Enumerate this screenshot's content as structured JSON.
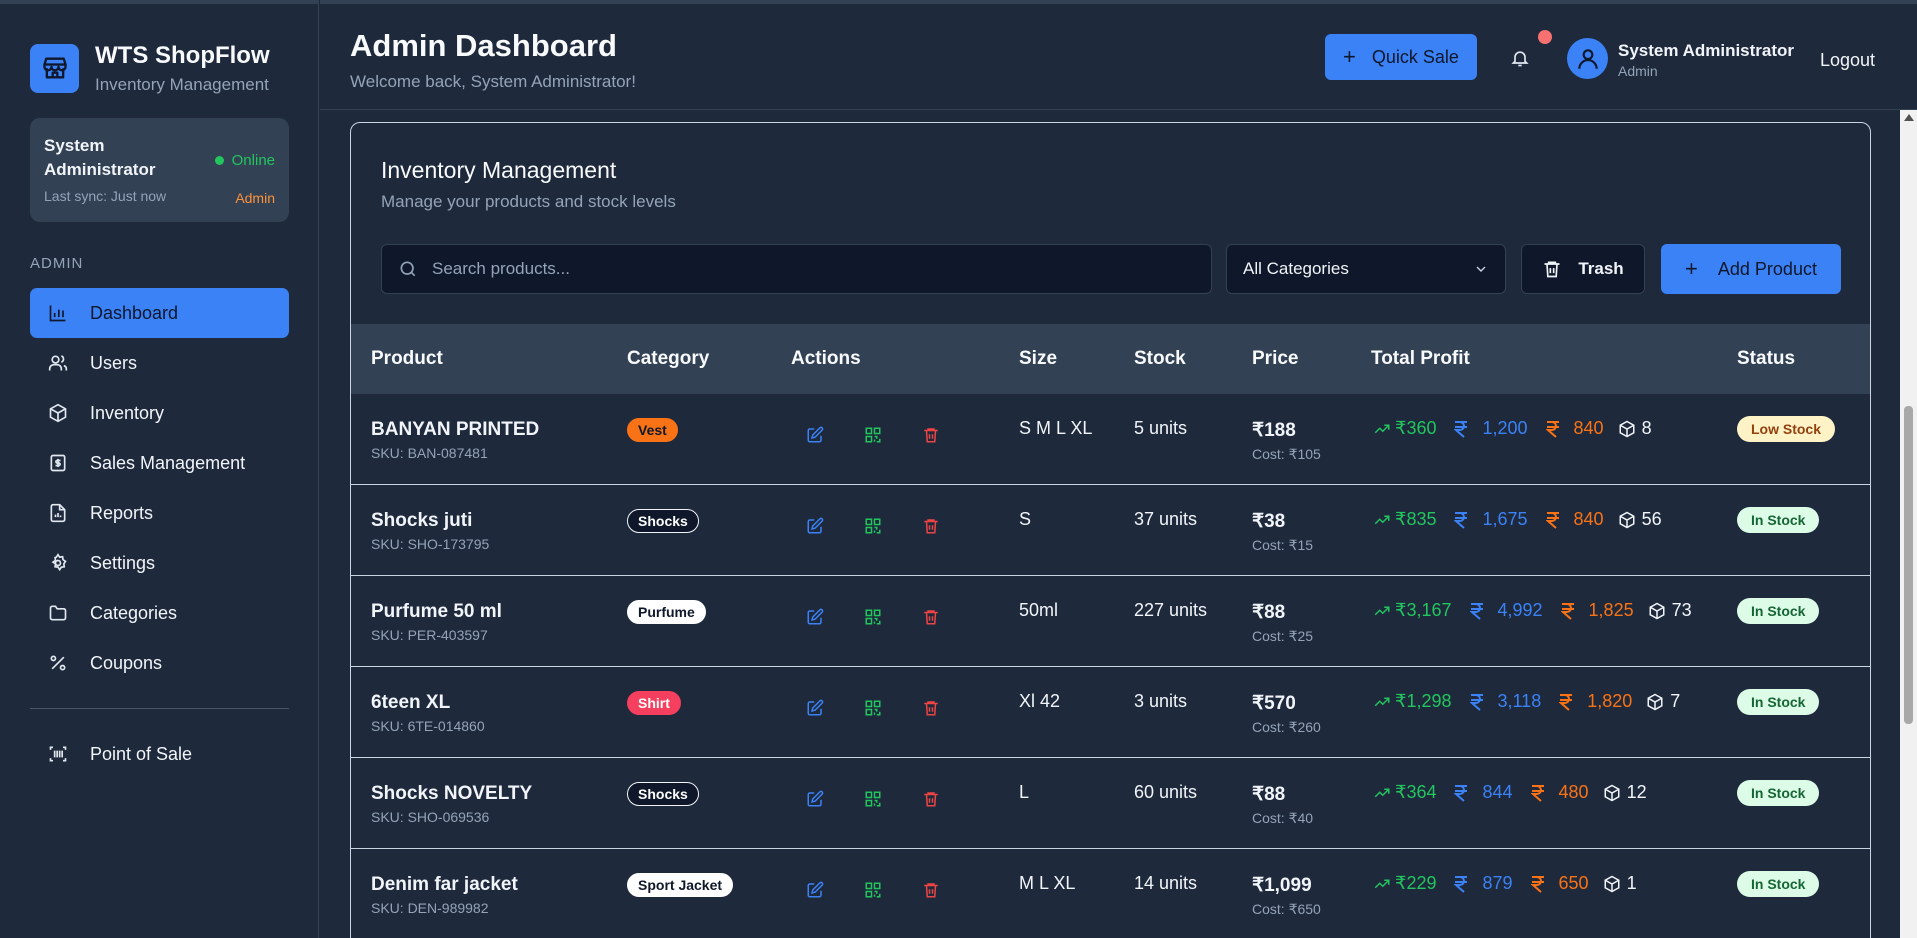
{
  "sidebar": {
    "brand_title": "WTS ShopFlow",
    "brand_subtitle": "Inventory Management",
    "user": {
      "name": "System Administrator",
      "status": "Online",
      "sync": "Last sync: Just now",
      "role": "Admin"
    },
    "section_label": "ADMIN",
    "items": [
      {
        "label": "Dashboard",
        "icon": "bar-chart-icon",
        "active": true
      },
      {
        "label": "Users",
        "icon": "users-icon"
      },
      {
        "label": "Inventory",
        "icon": "box-icon"
      },
      {
        "label": "Sales Management",
        "icon": "receipt-icon"
      },
      {
        "label": "Reports",
        "icon": "report-icon"
      },
      {
        "label": "Settings",
        "icon": "gear-icon"
      },
      {
        "label": "Categories",
        "icon": "folder-icon"
      },
      {
        "label": "Coupons",
        "icon": "percent-icon"
      }
    ],
    "pos_label": "Point of Sale"
  },
  "header": {
    "title": "Admin Dashboard",
    "subtitle": "Welcome back, System Administrator!",
    "quick_sale": "Quick Sale",
    "user_name": "System Administrator",
    "user_role": "Admin",
    "logout": "Logout"
  },
  "inventory": {
    "title": "Inventory Management",
    "subtitle": "Manage your products and stock levels",
    "search_placeholder": "Search products...",
    "category_filter": "All Categories",
    "trash_label": "Trash",
    "add_label": "Add Product",
    "columns": [
      "Product",
      "Category",
      "Actions",
      "Size",
      "Stock",
      "Price",
      "Total Profit",
      "Status"
    ],
    "rows": [
      {
        "name": "BANYAN PRINTED",
        "sku": "SKU: BAN-087481",
        "category": "Vest",
        "cat_bg": "#f97316",
        "cat_fg": "#0f172a",
        "size": "S M L XL",
        "stock": "5 units",
        "price": "₹188",
        "cost": "Cost: ₹105",
        "profit": "₹360",
        "revenue": "1,200",
        "expense": "840",
        "qty": "8",
        "status": "Low Stock",
        "status_bg": "#fef3c7",
        "status_fg": "#92400e"
      },
      {
        "name": "Shocks juti",
        "sku": "SKU: SHO-173795",
        "category": "Shocks",
        "cat_bg": "#0f172a",
        "cat_fg": "#ffffff",
        "size": "S",
        "stock": "37 units",
        "price": "₹38",
        "cost": "Cost: ₹15",
        "profit": "₹835",
        "revenue": "1,675",
        "expense": "840",
        "qty": "56",
        "status": "In Stock",
        "status_bg": "#dcfce7",
        "status_fg": "#166534"
      },
      {
        "name": "Purfume 50 ml",
        "sku": "SKU: PER-403597",
        "category": "Purfume",
        "cat_bg": "#ffffff",
        "cat_fg": "#0f172a",
        "size": "50ml",
        "stock": "227 units",
        "price": "₹88",
        "cost": "Cost: ₹25",
        "profit": "₹3,167",
        "revenue": "4,992",
        "expense": "1,825",
        "qty": "73",
        "status": "In Stock",
        "status_bg": "#dcfce7",
        "status_fg": "#166534"
      },
      {
        "name": "6teen XL",
        "sku": "SKU: 6TE-014860",
        "category": "Shirt",
        "cat_bg": "#f43f5e",
        "cat_fg": "#ffffff",
        "size": "Xl 42",
        "stock": "3 units",
        "price": "₹570",
        "cost": "Cost: ₹260",
        "profit": "₹1,298",
        "revenue": "3,118",
        "expense": "1,820",
        "qty": "7",
        "status": "In Stock",
        "status_bg": "#dcfce7",
        "status_fg": "#166534"
      },
      {
        "name": "Shocks NOVELTY",
        "sku": "SKU: SHO-069536",
        "category": "Shocks",
        "cat_bg": "#0f172a",
        "cat_fg": "#ffffff",
        "size": "L",
        "stock": "60 units",
        "price": "₹88",
        "cost": "Cost: ₹40",
        "profit": "₹364",
        "revenue": "844",
        "expense": "480",
        "qty": "12",
        "status": "In Stock",
        "status_bg": "#dcfce7",
        "status_fg": "#166534"
      },
      {
        "name": "Denim far jacket",
        "sku": "SKU: DEN-989982",
        "category": "Sport Jacket",
        "cat_bg": "#ffffff",
        "cat_fg": "#0f172a",
        "size": "M L XL",
        "stock": "14 units",
        "price": "₹1,099",
        "cost": "Cost: ₹650",
        "profit": "₹229",
        "revenue": "879",
        "expense": "650",
        "qty": "1",
        "status": "In Stock",
        "status_bg": "#dcfce7",
        "status_fg": "#166534"
      }
    ]
  },
  "colors": {
    "accent": "#3b82f6",
    "success": "#22c55e",
    "warning": "#f97316",
    "danger": "#ef4444"
  }
}
